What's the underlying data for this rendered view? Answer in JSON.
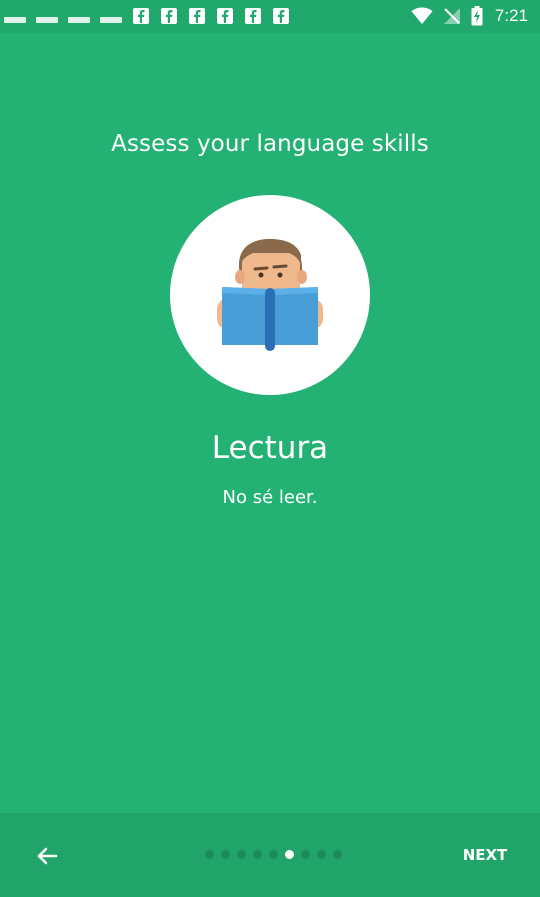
{
  "status_bar": {
    "time": "7:21",
    "notification_icons": [
      "notification-bar",
      "notification-bar",
      "notification-bar",
      "notification-bar",
      "facebook",
      "facebook",
      "facebook",
      "facebook",
      "facebook",
      "facebook"
    ],
    "right_icons": [
      "wifi-icon",
      "no-signal-icon",
      "battery-charging-icon"
    ]
  },
  "main": {
    "heading": "Assess your language skills",
    "illustration_icon": "person-reading-book-icon",
    "lesson_title": "Lectura",
    "lesson_subtitle": "No sé leer."
  },
  "bottom_nav": {
    "back_icon": "arrow-left-icon",
    "page_count": 9,
    "active_page": 6,
    "next_label": "NEXT"
  },
  "colors": {
    "background": "#23b274",
    "bottom_bar": "#20a46a",
    "text": "#ffffff",
    "dot_inactive": "#1a8a59",
    "dot_active": "#ffffff"
  }
}
